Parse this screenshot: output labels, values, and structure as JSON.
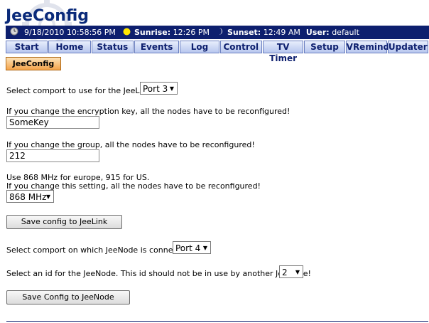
{
  "app": {
    "title": "JeeConfig"
  },
  "status": {
    "datetime": "9/18/2010 10:58:56 PM",
    "sunrise_label": "Sunrise:",
    "sunrise_value": "12:26 PM",
    "sunset_label": "Sunset:",
    "sunset_value": "12:49 AM",
    "user_label": "User:",
    "user_value": "default"
  },
  "nav": {
    "tabs": [
      "Start",
      "Home",
      "Status",
      "Events",
      "Log",
      "Control",
      "TV Timer",
      "Setup",
      "VRemind",
      "Updater"
    ]
  },
  "subtab": {
    "label": "JeeConfig"
  },
  "form": {
    "comport_label": "Select comport to use for the JeeLink:",
    "comport_value": "Port 3",
    "key_hint": "If you change the encryption key, all the nodes have to be reconfigured!",
    "key_value": "SomeKey",
    "group_hint": "If you change the group, all the nodes have to be reconfigured!",
    "group_value": "212",
    "freq_hint1": "Use 868 MHz for europe, 915 for US.",
    "freq_hint2": "If you change this setting, all the nodes have to be reconfigured!",
    "freq_value": "868 MHz",
    "save_jeelink": "Save config to JeeLink",
    "node_port_label": "Select comport on which JeeNode is connected:",
    "node_port_value": "Port 4",
    "node_id_label": "Select an id for the JeeNode. This id should not be in use by another JeeNode!",
    "node_id_value": "2",
    "save_jeenode": "Save Config to JeeNode"
  },
  "icons": {
    "clock": "clock-icon",
    "sun": "sun-icon",
    "moon": "moon-icon",
    "dropdown": "chevron-down-icon"
  },
  "colors": {
    "header_bg": "#0d1f6e",
    "title": "#0a2a7a",
    "active_tab": "#f4a34a"
  }
}
